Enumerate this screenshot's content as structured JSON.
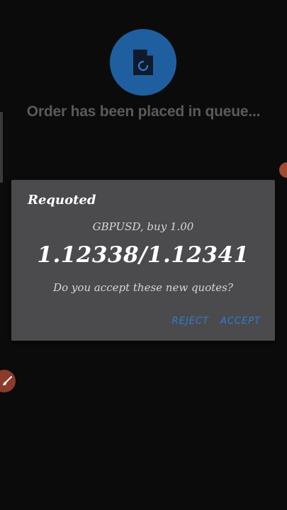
{
  "status": {
    "icon": "document-loading-icon",
    "message": "Order has been placed in queue..."
  },
  "dialog": {
    "title": "Requoted",
    "symbol_line": "GBPUSD, buy 1.00",
    "quotes": "1.12338/1.12341",
    "question": "Do you accept these new quotes?",
    "reject_label": "REJECT",
    "accept_label": "ACCEPT"
  },
  "colors": {
    "background": "#0b0b0c",
    "status_circle": "#1f5fa0",
    "dialog_bg": "#4b4b4d",
    "button_accent": "#2e7bd6"
  }
}
